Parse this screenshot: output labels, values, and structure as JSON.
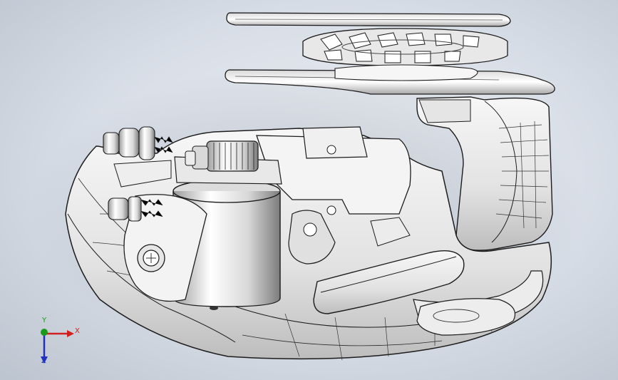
{
  "viewport": {
    "background_top": "#eef1f6",
    "background_edge": "#bcc4cf"
  },
  "model": {
    "part_color": "#f2f2f2",
    "edge_color": "#1c1c1c",
    "shade_color": "#b7b7b7"
  },
  "triad": {
    "x_label": "X",
    "y_label": "Y",
    "z_label": "Z",
    "x_color": "#d02020",
    "y_color": "#1a9a1a",
    "z_color": "#2030c0"
  }
}
